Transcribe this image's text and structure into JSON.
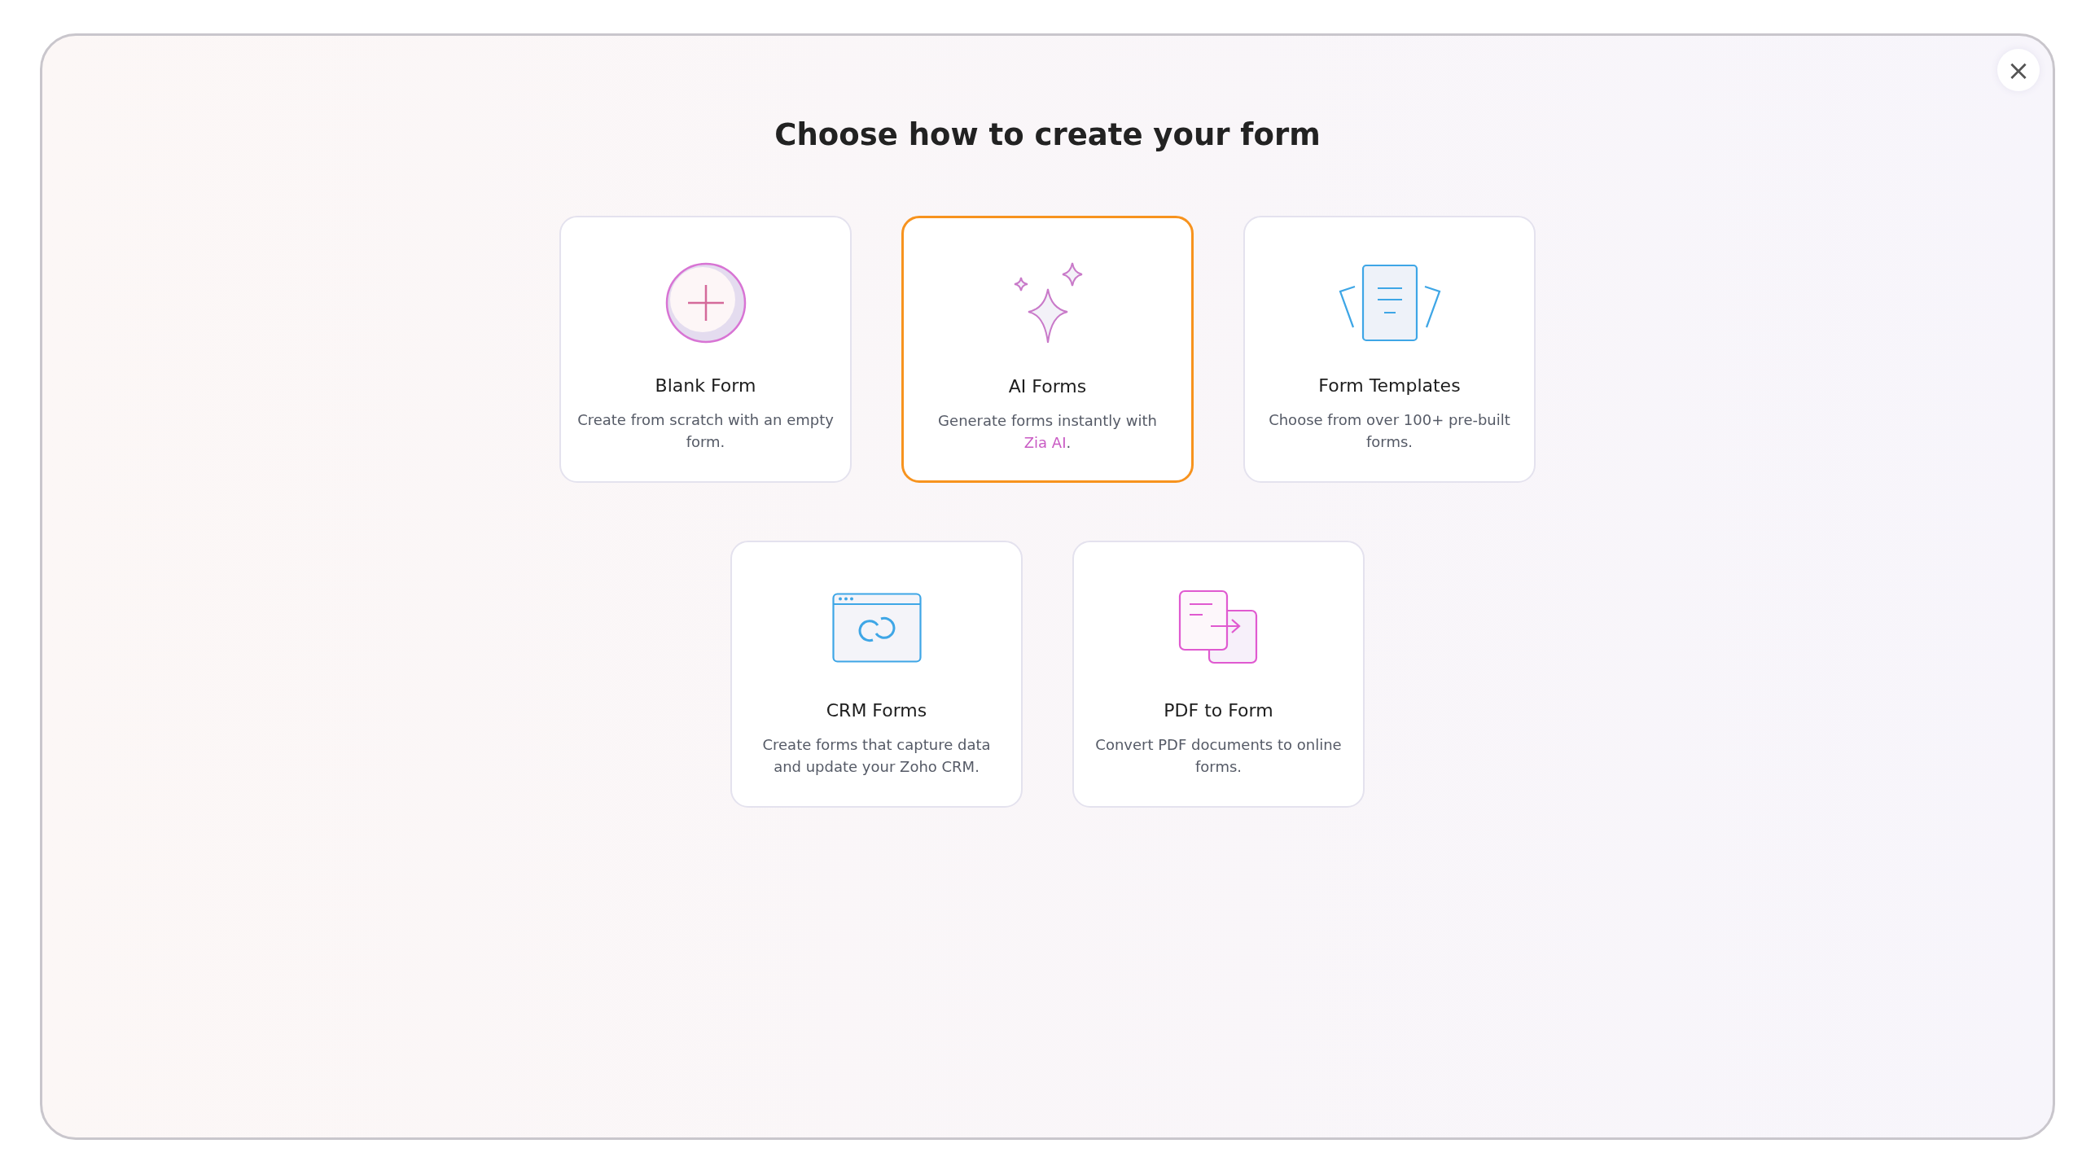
{
  "dialog": {
    "title": "Choose how to create your form",
    "close_label": "×"
  },
  "options": [
    {
      "kind": "blank",
      "title": "Blank Form",
      "description": "Create from scratch with an empty form.",
      "selected": false
    },
    {
      "kind": "ai",
      "title": "AI Forms",
      "description": "Generate forms instantly with",
      "link": "Zia AI",
      "description_end": ".",
      "selected": true
    },
    {
      "kind": "templates",
      "title": "Form Templates",
      "description": "Choose from over 100+ pre-built forms.",
      "selected": false
    },
    {
      "kind": "crm",
      "title": "CRM Forms",
      "description": "Create forms that capture data and update your Zoho CRM.",
      "selected": false
    },
    {
      "kind": "pdf",
      "title": "PDF to Form",
      "description": "Convert PDF documents to online forms.",
      "selected": false
    }
  ]
}
